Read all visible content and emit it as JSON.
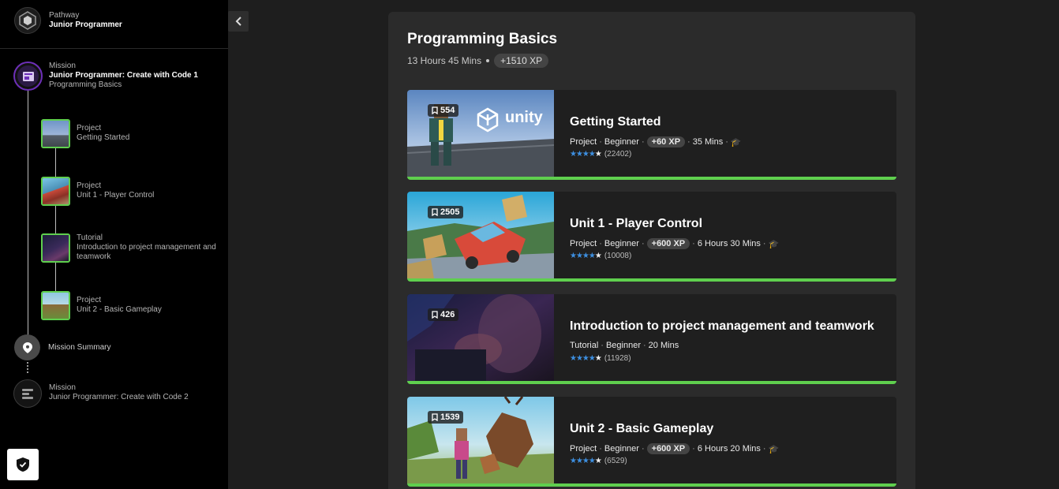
{
  "sidebar": {
    "pathway": {
      "label": "Pathway",
      "name": "Junior Programmer"
    },
    "mission1": {
      "label": "Mission",
      "name": "Junior Programmer: Create with Code 1",
      "sub": "Programming Basics"
    },
    "items": [
      {
        "type": "Project",
        "name": "Getting Started"
      },
      {
        "type": "Project",
        "name": "Unit 1 - Player Control"
      },
      {
        "type": "Tutorial",
        "name": "Introduction to project management and teamwork"
      },
      {
        "type": "Project",
        "name": "Unit 2 - Basic Gameplay"
      }
    ],
    "summary": "Mission Summary",
    "mission2": {
      "label": "Mission",
      "name": "Junior Programmer: Create with Code 2"
    }
  },
  "main": {
    "title": "Programming Basics",
    "hours": "13 Hours",
    "mins": "45 Mins",
    "xp": "+1510 XP"
  },
  "cards": [
    {
      "bookmarks": "554",
      "title": "Getting Started",
      "type": "Project",
      "level": "Beginner",
      "xp": "+60 XP",
      "duration": "35 Mins",
      "ratings": "(22402)",
      "thumb_logo": "unity"
    },
    {
      "bookmarks": "2505",
      "title": "Unit 1 - Player Control",
      "type": "Project",
      "level": "Beginner",
      "xp": "+600 XP",
      "duration": "6 Hours 30 Mins",
      "ratings": "(10008)"
    },
    {
      "bookmarks": "426",
      "title": "Introduction to project management and teamwork",
      "type": "Tutorial",
      "level": "Beginner",
      "duration": "20 Mins",
      "ratings": "(11928)"
    },
    {
      "bookmarks": "1539",
      "title": "Unit 2 - Basic Gameplay",
      "type": "Project",
      "level": "Beginner",
      "xp": "+600 XP",
      "duration": "6 Hours 20 Mins",
      "ratings": "(6529)"
    }
  ],
  "colors": {
    "accent_green": "#5fcf4e",
    "star_blue": "#3d8fe0",
    "mission_purple": "#6d2fb8"
  }
}
